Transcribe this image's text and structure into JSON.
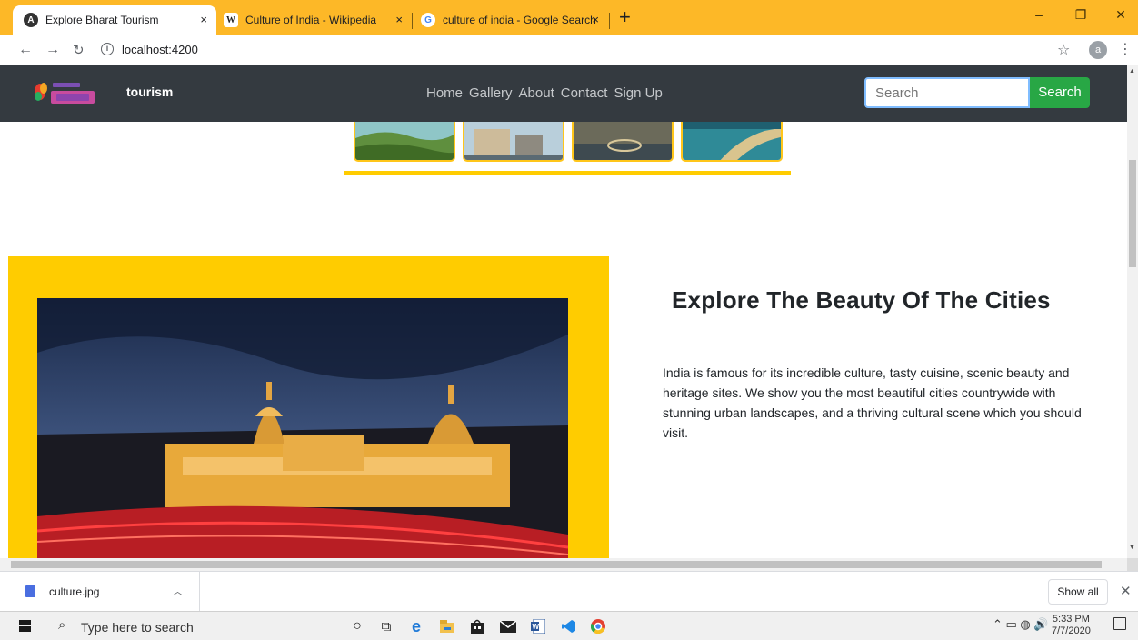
{
  "browser": {
    "tabs": [
      {
        "title": "Explore Bharat Tourism",
        "favicon": "angular-icon",
        "active": true
      },
      {
        "title": "Culture of India - Wikipedia",
        "favicon": "wikipedia-icon",
        "active": false
      },
      {
        "title": "culture of india - Google Search",
        "favicon": "google-icon",
        "active": false
      }
    ],
    "close_glyph": "×",
    "new_tab_glyph": "+",
    "url": "localhost:4200",
    "profile_initial": "a",
    "accent_color": "#fdb827"
  },
  "site": {
    "brand_suffix": "tourism",
    "nav_links": [
      "Home",
      "Gallery",
      "About",
      "Contact",
      "Sign Up"
    ],
    "search_placeholder": "Search",
    "search_button": "Search",
    "accent_color": "#ffcc00",
    "navbar_color": "#343a40",
    "button_color": "#28a745"
  },
  "feature": {
    "heading": "Explore The Beauty Of The Cities",
    "text": "India is famous for its incredible culture, tasty cuisine, scenic beauty and heritage sites. We show you the most beautiful cities countrywide with stunning urban landscapes, and a thriving cultural scene which you should visit."
  },
  "downloads": {
    "file_name": "culture.jpg",
    "show_all": "Show all"
  },
  "taskbar": {
    "search_placeholder": "Type here to search",
    "time": "5:33 PM",
    "date": "7/7/2020"
  }
}
